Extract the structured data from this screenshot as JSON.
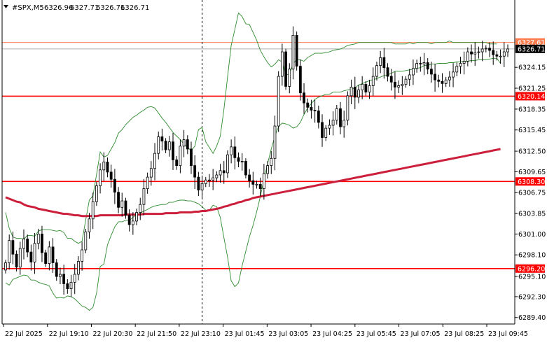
{
  "header": {
    "symbol": "#SPX,M5",
    "open": "6326.96",
    "high": "6327.71",
    "low": "6326.71",
    "close": "6326.71"
  },
  "colors": {
    "background": "#ffffff",
    "candle": "#000000",
    "bollinger": "#2e8b2e",
    "moving_average": "#cc1f3c",
    "level": "#ff0000",
    "ask_line": "#ff7f50",
    "bid_tag": "#000000",
    "axis": "#000000",
    "grid_dashed": "#000000"
  },
  "chart_data": {
    "type": "candlestick",
    "title": "#SPX,M5",
    "ylim": [
      6288.5,
      6333.5
    ],
    "y_ticks": [
      6289.4,
      6292.3,
      6295.1,
      6298.1,
      6301.0,
      6303.85,
      6306.75,
      6309.65,
      6312.5,
      6315.45,
      6318.35,
      6321.25,
      6324.15
    ],
    "y_tick_labels": [
      "6289.40",
      "6292.30",
      "6295.10",
      "6298.10",
      "6301.00",
      "6303.85",
      "6306.75",
      "6309.65",
      "6312.50",
      "6315.45",
      "6318.35",
      "6321.25",
      "6324.15"
    ],
    "x_tick_labels": [
      "22 Jul 2025",
      "22 Jul 19:10",
      "22 Jul 20:30",
      "22 Jul 21:50",
      "22 Jul 23:10",
      "23 Jul 01:45",
      "23 Jul 03:05",
      "23 Jul 04:25",
      "23 Jul 05:45",
      "23 Jul 07:05",
      "23 Jul 08:25",
      "23 Jul 09:45"
    ],
    "levels": [
      {
        "value": 6320.14,
        "label": "6320.14"
      },
      {
        "value": 6308.3,
        "label": "6308.30"
      },
      {
        "value": 6296.2,
        "label": "6296.20"
      }
    ],
    "ask_price": {
      "value": 6327.61,
      "label": "6327.61"
    },
    "bid_price": {
      "value": 6326.71,
      "label": "6326.71"
    },
    "period_separator_index": 54,
    "close": [
      6297.0,
      6300.1,
      6298.2,
      6296.4,
      6299.0,
      6300.3,
      6298.5,
      6297.1,
      6299.7,
      6301.0,
      6298.4,
      6296.9,
      6299.2,
      6297.0,
      6295.1,
      6295.4,
      6294.1,
      6293.4,
      6294.3,
      6295.4,
      6297.2,
      6298.8,
      6301.3,
      6303.1,
      6305.5,
      6307.7,
      6309.9,
      6311.0,
      6309.6,
      6308.6,
      6306.8,
      6304.7,
      6305.6,
      6303.6,
      6302.3,
      6302.8,
      6304.0,
      6305.1,
      6307.3,
      6308.9,
      6310.1,
      6312.2,
      6314.5,
      6313.9,
      6312.7,
      6313.8,
      6311.3,
      6310.5,
      6313.2,
      6314.1,
      6312.8,
      6310.5,
      6308.9,
      6307.1,
      6308.0,
      6308.5,
      6308.5,
      6308.8,
      6309.2,
      6309.8,
      6309.5,
      6312.0,
      6313.1,
      6311.6,
      6311.1,
      6311.1,
      6309.2,
      6308.4,
      6307.9,
      6307.9,
      6307.3,
      6309.4,
      6310.5,
      6311.5,
      6316.0,
      6322.9,
      6326.3,
      6321.5,
      6323.9,
      6328.6,
      6324.3,
      6320.6,
      6319.2,
      6318.6,
      6318.2,
      6318.1,
      6316.5,
      6314.4,
      6315.7,
      6316.1,
      6316.8,
      6318.4,
      6315.9,
      6316.8,
      6320.2,
      6321.4,
      6320.0,
      6321.0,
      6321.8,
      6320.7,
      6321.6,
      6322.9,
      6324.4,
      6325.5,
      6324.1,
      6322.9,
      6322.1,
      6321.4,
      6321.6,
      6321.8,
      6322.5,
      6323.1,
      6324.0,
      6324.7,
      6324.6,
      6324.8,
      6323.9,
      6323.2,
      6322.4,
      6322.2,
      6321.9,
      6322.4,
      6322.8,
      6323.5,
      6324.3,
      6324.7,
      6325.0,
      6326.3,
      6326.0,
      6326.2,
      6326.3,
      6326.7,
      6326.8,
      6326.5,
      6325.9,
      6325.7,
      6325.7,
      6326.3,
      6326.7
    ],
    "bollinger_upper": [
      6304.0,
      6301.8,
      6300.6,
      6300.4,
      6300.4,
      6300.3,
      6300.8,
      6300.8,
      6300.7,
      6301.4,
      6301.6,
      6301.6,
      6301.6,
      6301.5,
      6301.4,
      6301.5,
      6301.2,
      6300.4,
      6300.4,
      6300.0,
      6299.7,
      6300.0,
      6302.9,
      6305.7,
      6306.3,
      6309.3,
      6312.4,
      6311.7,
      6311.9,
      6312.8,
      6313.7,
      6315.0,
      6315.5,
      6316.2,
      6316.7,
      6317.2,
      6317.5,
      6317.9,
      6318.2,
      6318.6,
      6318.7,
      6318.5,
      6317.8,
      6317.1,
      6316.5,
      6315.8,
      6315.1,
      6314.6,
      6314.1,
      6313.5,
      6313.0,
      6312.6,
      6313.2,
      6315.5,
      6315.8,
      6313.8,
      6313.0,
      6312.2,
      6313.2,
      6314.6,
      6318.3,
      6322.8,
      6327.2,
      6329.4,
      6331.7,
      6331.2,
      6330.2,
      6330.1,
      6329.0,
      6327.9,
      6326.5,
      6325.6,
      6324.8,
      6324.2,
      6324.6,
      6325.2,
      6324.9,
      6323.1,
      6323.2,
      6324.7,
      6325.2,
      6325.2,
      6325.0,
      6325.5,
      6325.8,
      6326.1,
      6326.1,
      6326.1,
      6326.2,
      6326.3,
      6326.5,
      6326.6,
      6326.7,
      6326.9,
      6327.2,
      6327.3,
      6327.4,
      6327.6,
      6327.6,
      6327.6,
      6327.6,
      6327.6,
      6327.6,
      6327.6,
      6327.6,
      6327.6,
      6327.6,
      6327.4,
      6327.4,
      6327.4,
      6327.4,
      6327.6,
      6327.4,
      6327.6,
      6327.6,
      6327.6,
      6327.6,
      6327.4,
      6327.6,
      6327.6,
      6327.6,
      6327.6,
      6327.8,
      6327.6,
      6327.6,
      6327.6,
      6327.6,
      6327.6,
      6327.6,
      6327.6,
      6327.6,
      6327.6,
      6327.6,
      6327.4,
      6327.4,
      6327.4
    ],
    "bollinger_lower": [
      6294.2,
      6293.9,
      6294.7,
      6294.9,
      6295.1,
      6295.3,
      6295.2,
      6294.6,
      6294.6,
      6294.3,
      6294.1,
      6294.0,
      6293.8,
      6292.8,
      6292.1,
      6292.2,
      6292.1,
      6292.4,
      6292.3,
      6292.0,
      6291.5,
      6291.0,
      6290.8,
      6290.4,
      6290.8,
      6292.8,
      6296.5,
      6296.8,
      6299.5,
      6300.8,
      6302.0,
      6302.7,
      6302.7,
      6302.9,
      6302.9,
      6303.3,
      6303.7,
      6303.9,
      6304.2,
      6304.4,
      6304.7,
      6304.9,
      6305.0,
      6305.1,
      6305.1,
      6305.4,
      6305.4,
      6305.6,
      6305.7,
      6305.7,
      6305.6,
      6305.6,
      6305.4,
      6305.2,
      6304.8,
      6304.3,
      6304.3,
      6305.0,
      6304.8,
      6303.3,
      6300.5,
      6297.8,
      6294.5,
      6293.7,
      6294.2,
      6296.6,
      6298.6,
      6300.6,
      6302.2,
      6304.1,
      6306.2,
      6308.6,
      6310.8,
      6312.8,
      6314.6,
      6315.9,
      6316.4,
      6316.3,
      6316.1,
      6315.7,
      6315.9,
      6316.5,
      6317.6,
      6318.5,
      6319.1,
      6319.7,
      6320.0,
      6320.2,
      6320.4,
      6320.4,
      6320.7,
      6320.7,
      6320.7,
      6320.9,
      6321.0,
      6321.1,
      6321.3,
      6321.7,
      6321.9,
      6322.1,
      6322.3,
      6322.4,
      6322.6,
      6322.8,
      6323.0,
      6323.1,
      6323.3,
      6323.6,
      6323.6,
      6323.6,
      6323.7,
      6323.8,
      6323.9,
      6324.0,
      6324.1,
      6324.4,
      6324.4,
      6324.6,
      6324.6,
      6324.7,
      6324.7,
      6324.7,
      6324.8,
      6324.8,
      6324.9,
      6324.9,
      6325.0,
      6325.0,
      6325.1,
      6325.1,
      6325.2,
      6325.2,
      6325.2,
      6325.3,
      6325.4,
      6325.4,
      6324.7
    ],
    "moving_average": [
      6306.1,
      6305.9,
      6305.7,
      6305.5,
      6305.4,
      6305.1,
      6304.9,
      6304.8,
      6304.7,
      6304.5,
      6304.4,
      6304.3,
      6304.2,
      6304.1,
      6304.0,
      6303.9,
      6303.8,
      6303.8,
      6303.7,
      6303.6,
      6303.6,
      6303.5,
      6303.5,
      6303.5,
      6303.5,
      6303.5,
      6303.6,
      6303.6,
      6303.6,
      6303.6,
      6303.6,
      6303.6,
      6303.6,
      6303.7,
      6303.7,
      6303.7,
      6303.7,
      6303.7,
      6303.8,
      6303.8,
      6303.8,
      6303.8,
      6303.8,
      6303.8,
      6303.9,
      6303.9,
      6303.9,
      6303.9,
      6304.0,
      6304.0,
      6304.0,
      6304.0,
      6304.1,
      6304.1,
      6304.2,
      6304.2,
      6304.3,
      6304.4,
      6304.5,
      6304.6,
      6304.8,
      6304.9,
      6305.1,
      6305.2,
      6305.4,
      6305.5,
      6305.7,
      6305.8,
      6306.0,
      6306.1,
      6306.2,
      6306.3,
      6306.4,
      6306.5,
      6306.6,
      6306.7,
      6306.8,
      6306.9,
      6307.0,
      6307.1,
      6307.2,
      6307.3,
      6307.4,
      6307.5,
      6307.6,
      6307.7,
      6307.8,
      6307.9,
      6308.0,
      6308.1,
      6308.2,
      6308.3,
      6308.4,
      6308.5,
      6308.6,
      6308.7,
      6308.8,
      6308.9,
      6309.0,
      6309.1,
      6309.2,
      6309.3,
      6309.4,
      6309.5,
      6309.6,
      6309.7,
      6309.8,
      6309.9,
      6310.0,
      6310.1,
      6310.2,
      6310.3,
      6310.4,
      6310.5,
      6310.6,
      6310.7,
      6310.8,
      6310.9,
      6311.0,
      6311.1,
      6311.2,
      6311.3,
      6311.4,
      6311.5,
      6311.6,
      6311.7,
      6311.8,
      6311.9,
      6312.0,
      6312.1,
      6312.2,
      6312.3,
      6312.4,
      6312.5,
      6312.6,
      6312.7,
      6312.8
    ]
  }
}
